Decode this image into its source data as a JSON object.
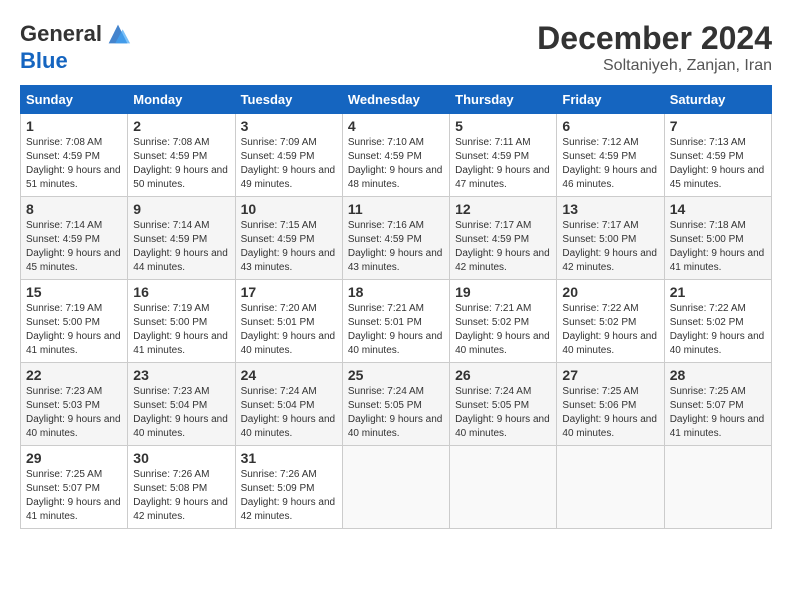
{
  "header": {
    "logo": {
      "general": "General",
      "blue": "Blue"
    },
    "month": "December 2024",
    "location": "Soltaniyeh, Zanjan, Iran"
  },
  "days_of_week": [
    "Sunday",
    "Monday",
    "Tuesday",
    "Wednesday",
    "Thursday",
    "Friday",
    "Saturday"
  ],
  "weeks": [
    [
      {
        "day": 1,
        "sunrise": "7:08 AM",
        "sunset": "4:59 PM",
        "daylight": "9 hours and 51 minutes."
      },
      {
        "day": 2,
        "sunrise": "7:08 AM",
        "sunset": "4:59 PM",
        "daylight": "9 hours and 50 minutes."
      },
      {
        "day": 3,
        "sunrise": "7:09 AM",
        "sunset": "4:59 PM",
        "daylight": "9 hours and 49 minutes."
      },
      {
        "day": 4,
        "sunrise": "7:10 AM",
        "sunset": "4:59 PM",
        "daylight": "9 hours and 48 minutes."
      },
      {
        "day": 5,
        "sunrise": "7:11 AM",
        "sunset": "4:59 PM",
        "daylight": "9 hours and 47 minutes."
      },
      {
        "day": 6,
        "sunrise": "7:12 AM",
        "sunset": "4:59 PM",
        "daylight": "9 hours and 46 minutes."
      },
      {
        "day": 7,
        "sunrise": "7:13 AM",
        "sunset": "4:59 PM",
        "daylight": "9 hours and 45 minutes."
      }
    ],
    [
      {
        "day": 8,
        "sunrise": "7:14 AM",
        "sunset": "4:59 PM",
        "daylight": "9 hours and 45 minutes."
      },
      {
        "day": 9,
        "sunrise": "7:14 AM",
        "sunset": "4:59 PM",
        "daylight": "9 hours and 44 minutes."
      },
      {
        "day": 10,
        "sunrise": "7:15 AM",
        "sunset": "4:59 PM",
        "daylight": "9 hours and 43 minutes."
      },
      {
        "day": 11,
        "sunrise": "7:16 AM",
        "sunset": "4:59 PM",
        "daylight": "9 hours and 43 minutes."
      },
      {
        "day": 12,
        "sunrise": "7:17 AM",
        "sunset": "4:59 PM",
        "daylight": "9 hours and 42 minutes."
      },
      {
        "day": 13,
        "sunrise": "7:17 AM",
        "sunset": "5:00 PM",
        "daylight": "9 hours and 42 minutes."
      },
      {
        "day": 14,
        "sunrise": "7:18 AM",
        "sunset": "5:00 PM",
        "daylight": "9 hours and 41 minutes."
      }
    ],
    [
      {
        "day": 15,
        "sunrise": "7:19 AM",
        "sunset": "5:00 PM",
        "daylight": "9 hours and 41 minutes."
      },
      {
        "day": 16,
        "sunrise": "7:19 AM",
        "sunset": "5:00 PM",
        "daylight": "9 hours and 41 minutes."
      },
      {
        "day": 17,
        "sunrise": "7:20 AM",
        "sunset": "5:01 PM",
        "daylight": "9 hours and 40 minutes."
      },
      {
        "day": 18,
        "sunrise": "7:21 AM",
        "sunset": "5:01 PM",
        "daylight": "9 hours and 40 minutes."
      },
      {
        "day": 19,
        "sunrise": "7:21 AM",
        "sunset": "5:02 PM",
        "daylight": "9 hours and 40 minutes."
      },
      {
        "day": 20,
        "sunrise": "7:22 AM",
        "sunset": "5:02 PM",
        "daylight": "9 hours and 40 minutes."
      },
      {
        "day": 21,
        "sunrise": "7:22 AM",
        "sunset": "5:02 PM",
        "daylight": "9 hours and 40 minutes."
      }
    ],
    [
      {
        "day": 22,
        "sunrise": "7:23 AM",
        "sunset": "5:03 PM",
        "daylight": "9 hours and 40 minutes."
      },
      {
        "day": 23,
        "sunrise": "7:23 AM",
        "sunset": "5:04 PM",
        "daylight": "9 hours and 40 minutes."
      },
      {
        "day": 24,
        "sunrise": "7:24 AM",
        "sunset": "5:04 PM",
        "daylight": "9 hours and 40 minutes."
      },
      {
        "day": 25,
        "sunrise": "7:24 AM",
        "sunset": "5:05 PM",
        "daylight": "9 hours and 40 minutes."
      },
      {
        "day": 26,
        "sunrise": "7:24 AM",
        "sunset": "5:05 PM",
        "daylight": "9 hours and 40 minutes."
      },
      {
        "day": 27,
        "sunrise": "7:25 AM",
        "sunset": "5:06 PM",
        "daylight": "9 hours and 40 minutes."
      },
      {
        "day": 28,
        "sunrise": "7:25 AM",
        "sunset": "5:07 PM",
        "daylight": "9 hours and 41 minutes."
      }
    ],
    [
      {
        "day": 29,
        "sunrise": "7:25 AM",
        "sunset": "5:07 PM",
        "daylight": "9 hours and 41 minutes."
      },
      {
        "day": 30,
        "sunrise": "7:26 AM",
        "sunset": "5:08 PM",
        "daylight": "9 hours and 42 minutes."
      },
      {
        "day": 31,
        "sunrise": "7:26 AM",
        "sunset": "5:09 PM",
        "daylight": "9 hours and 42 minutes."
      },
      null,
      null,
      null,
      null
    ]
  ],
  "labels": {
    "sunrise": "Sunrise:",
    "sunset": "Sunset:",
    "daylight": "Daylight:"
  }
}
